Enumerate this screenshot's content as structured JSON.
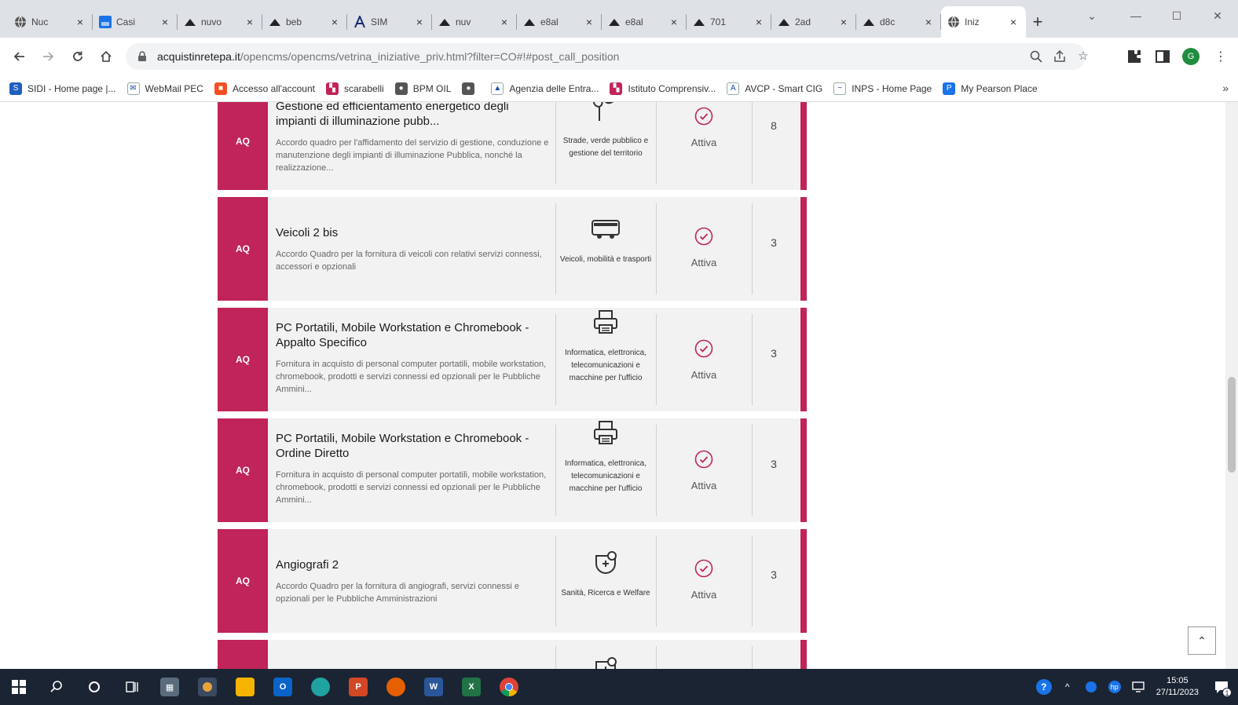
{
  "browser": {
    "tabs": [
      {
        "title": "Nuc",
        "icon": "globe-icon",
        "icon_color": "#555"
      },
      {
        "title": "Casi",
        "icon": "app-icon",
        "icon_color": "#1a73e8"
      },
      {
        "title": "nuvo",
        "icon": "cloud-icon",
        "icon_color": "#222"
      },
      {
        "title": "beb",
        "icon": "cloud-icon",
        "icon_color": "#222"
      },
      {
        "title": "SIM",
        "icon": "avcp-icon",
        "icon_color": "#1a2a6c"
      },
      {
        "title": "nuv",
        "icon": "cloud-icon",
        "icon_color": "#222"
      },
      {
        "title": "e8al",
        "icon": "cloud-icon",
        "icon_color": "#222"
      },
      {
        "title": "e8al",
        "icon": "cloud-icon",
        "icon_color": "#222"
      },
      {
        "title": "701",
        "icon": "cloud-icon",
        "icon_color": "#222"
      },
      {
        "title": "2ad",
        "icon": "cloud-icon",
        "icon_color": "#222"
      },
      {
        "title": "d8c",
        "icon": "cloud-icon",
        "icon_color": "#222"
      },
      {
        "title": "Iniz",
        "icon": "globe-icon",
        "icon_color": "#555",
        "active": true
      }
    ],
    "new_tab_symbol": "+",
    "window_controls": {
      "dropdown": "⌄",
      "minimize": "—",
      "maximize": "☐",
      "close": "✕"
    },
    "url_host": "acquistinretepa.it",
    "url_path": "/opencms/opencms/vetrina_iniziative_priv.html?filter=CO#!#post_call_position",
    "profile_initial": "G",
    "bookmarks": [
      {
        "label": "SIDI - Home page |...",
        "icon_color": "#1f5fbf",
        "icon_char": "S"
      },
      {
        "label": "WebMail PEC",
        "icon_color": "#ffffff",
        "icon_char": "✉"
      },
      {
        "label": "Accesso all'account",
        "icon_color": "#f25022",
        "icon_char": "■"
      },
      {
        "label": "scarabelli",
        "icon_color": "#c0245a",
        "icon_char": "▚"
      },
      {
        "label": "BPM OIL",
        "icon_color": "#555555",
        "icon_char": "●"
      },
      {
        "label": "",
        "icon_color": "#555555",
        "icon_char": "●"
      },
      {
        "label": "Agenzia delle Entra...",
        "icon_color": "#ffffff",
        "icon_char": "▲"
      },
      {
        "label": "Istituto Comprensiv...",
        "icon_color": "#c0245a",
        "icon_char": "▚"
      },
      {
        "label": "AVCP - Smart CIG",
        "icon_color": "#ffffff",
        "icon_char": "A"
      },
      {
        "label": "INPS - Home Page",
        "icon_color": "#ffffff",
        "icon_char": "~"
      },
      {
        "label": "My Pearson Place",
        "icon_color": "#1a73e8",
        "icon_char": "P"
      }
    ],
    "bookmarks_more": "»"
  },
  "initiatives": [
    {
      "type": "AQ",
      "title": "Gestione ed efficientamento energetico degli impianti di illuminazione pubb...",
      "description": "Accordo quadro per l'affidamento del servizio di gestione, conduzione e manutenzione degli impianti di illuminazione Pubblica, nonché la realizzazione...",
      "category": "Strade, verde pubblico e gestione del territorio",
      "category_icon": "tree-icon",
      "status": "Attiva",
      "count": "8"
    },
    {
      "type": "AQ",
      "title": "Veicoli 2 bis",
      "description": "Accordo Quadro per la fornitura di veicoli con relativi servizi connessi, accessori e opzionali",
      "category": "Veicoli, mobilità e trasporti",
      "category_icon": "bus-icon",
      "status": "Attiva",
      "count": "3"
    },
    {
      "type": "AQ",
      "title": "PC Portatili, Mobile Workstation e Chromebook - Appalto Specifico",
      "description": "Fornitura in acquisto di personal computer portatili, mobile workstation, chromebook, prodotti e servizi connessi ed opzionali per le Pubbliche Ammini...",
      "category": "Informatica, elettronica, telecomunicazioni e macchine per l'ufficio",
      "category_icon": "printer-icon",
      "status": "Attiva",
      "count": "3"
    },
    {
      "type": "AQ",
      "title": "PC Portatili, Mobile Workstation e Chromebook - Ordine Diretto",
      "description": "Fornitura in acquisto di personal computer portatili, mobile workstation, chromebook, prodotti e servizi connessi ed opzionali per le Pubbliche Ammini...",
      "category": "Informatica, elettronica, telecomunicazioni e macchine per l'ufficio",
      "category_icon": "printer-icon",
      "status": "Attiva",
      "count": "3"
    },
    {
      "type": "AQ",
      "title": "Angiografi 2",
      "description": "Accordo Quadro per la fornitura di angiografi, servizi connessi e opzionali per le Pubbliche Amministrazioni",
      "category": "Sanità, Ricerca e Welfare",
      "category_icon": "health-icon",
      "status": "Attiva",
      "count": "3"
    },
    {
      "type": "",
      "title": "",
      "description": "",
      "category": "",
      "category_icon": "health-icon",
      "status": "",
      "count": ""
    }
  ],
  "back_to_top": "⌃",
  "accent_color": "#c0245a",
  "taskbar": {
    "time": "15:05",
    "date": "27/11/2023",
    "notification_count": "1"
  }
}
